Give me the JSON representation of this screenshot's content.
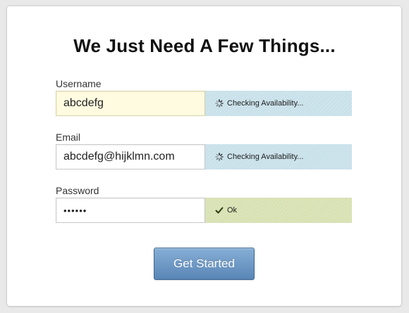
{
  "form": {
    "title": "We Just Need A Few Things...",
    "submit_label": "Get Started",
    "fields": [
      {
        "label": "Username",
        "value": "abcdefg",
        "status": "Checking Availability...",
        "status_icon": "spinner-icon"
      },
      {
        "label": "Email",
        "value": "abcdefg@hijklmn.com",
        "status": "Checking Availability...",
        "status_icon": "spinner-icon"
      },
      {
        "label": "Password",
        "value": "••••••",
        "status": "Ok",
        "status_icon": "checkmark-icon"
      }
    ]
  },
  "colors": {
    "focused_input_bg": "#fefbe0",
    "checking_bg": "#c9e1ea",
    "ok_bg": "#d8e1b3",
    "button_top": "#86aed6",
    "button_bottom": "#5a86b6"
  }
}
